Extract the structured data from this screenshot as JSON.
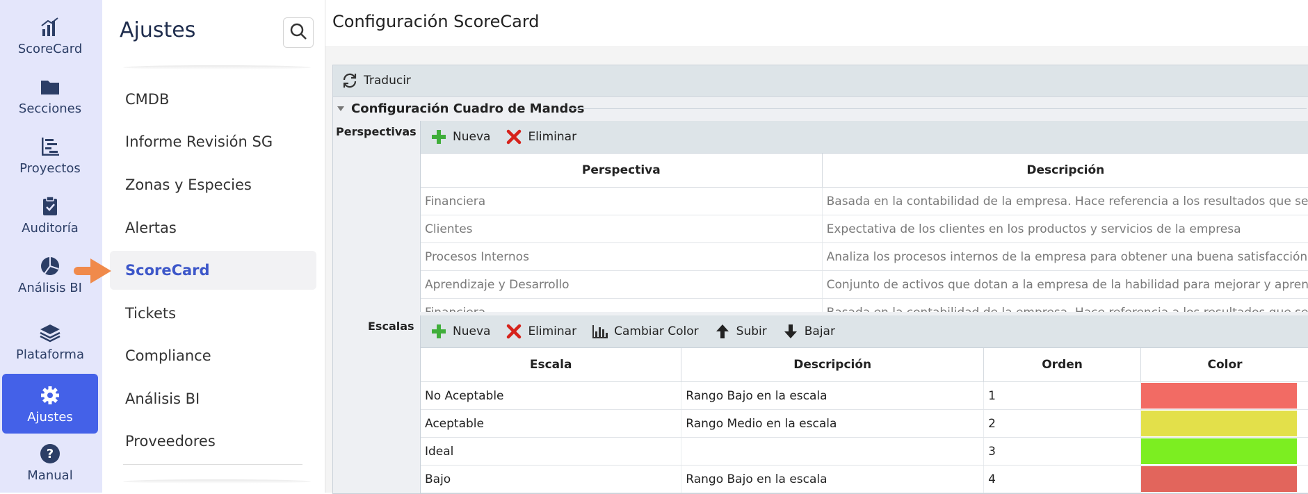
{
  "rail": {
    "items": [
      {
        "label": "ScoreCard",
        "icon": "bar-chart-icon"
      },
      {
        "label": "Secciones",
        "icon": "folder-icon"
      },
      {
        "label": "Proyectos",
        "icon": "gantt-icon"
      },
      {
        "label": "Auditoría",
        "icon": "clipboard-check-icon"
      },
      {
        "label": "Análisis BI",
        "icon": "pie-chart-icon"
      },
      {
        "label": "Plataforma",
        "icon": "layers-icon"
      },
      {
        "label": "Ajustes",
        "icon": "gear-icon",
        "active": true
      },
      {
        "label": "Manual",
        "icon": "help-icon"
      }
    ]
  },
  "settings": {
    "title": "Ajustes",
    "search_icon": "search-icon",
    "items": [
      {
        "label": "CMDB"
      },
      {
        "label": "Informe Revisión SG"
      },
      {
        "label": "Zonas y Especies"
      },
      {
        "label": "Alertas"
      },
      {
        "label": "ScoreCard",
        "active": true
      },
      {
        "label": "Tickets"
      },
      {
        "label": "Compliance"
      },
      {
        "label": "Análisis BI"
      },
      {
        "label": "Proveedores"
      }
    ]
  },
  "main": {
    "title": "Configuración ScoreCard",
    "toolbar": {
      "translate_label": "Traducir"
    },
    "section_title": "Configuración Cuadro de Mandos",
    "perspectives": {
      "label": "Perspectivas",
      "toolbar": {
        "new_label": "Nueva",
        "delete_label": "Eliminar"
      },
      "columns": [
        "Perspectiva",
        "Descripción"
      ],
      "rows": [
        [
          "Financiera",
          "Basada en la contabilidad de la empresa. Hace referencia a los resultados que se"
        ],
        [
          "Clientes",
          "Expectativa de los clientes en los productos y servicios de la empresa"
        ],
        [
          "Procesos Internos",
          "Analiza los procesos internos de la empresa para obtener una buena satisfacción"
        ],
        [
          "Aprendizaje y Desarrollo",
          "Conjunto de activos que dotan a la empresa de la habilidad para mejorar y apren"
        ],
        [
          "Financiera",
          "Basada en la contabilidad de la empresa. Hace referencia a los resultados que se"
        ]
      ]
    },
    "scales": {
      "label": "Escalas",
      "toolbar": {
        "new_label": "Nueva",
        "delete_label": "Eliminar",
        "color_label": "Cambiar Color",
        "up_label": "Subir",
        "down_label": "Bajar"
      },
      "columns": [
        "Escala",
        "Descripción",
        "Orden",
        "Color"
      ],
      "rows": [
        {
          "escala": "No Aceptable",
          "descripcion": "Rango Bajo en la escala",
          "orden": "1",
          "color": "#f26b64"
        },
        {
          "escala": "Aceptable",
          "descripcion": "Rango Medio en la escala",
          "orden": "2",
          "color": "#e3e04a"
        },
        {
          "escala": "Ideal",
          "descripcion": "",
          "orden": "3",
          "color": "#7cee21"
        },
        {
          "escala": "Bajo",
          "descripcion": "Rango Bajo en la escala",
          "orden": "4",
          "color": "#e2655c"
        }
      ]
    }
  },
  "colors": {
    "accent": "#4461e8",
    "rail_bg": "#e4e6fb",
    "pointer": "#f08a4b"
  }
}
